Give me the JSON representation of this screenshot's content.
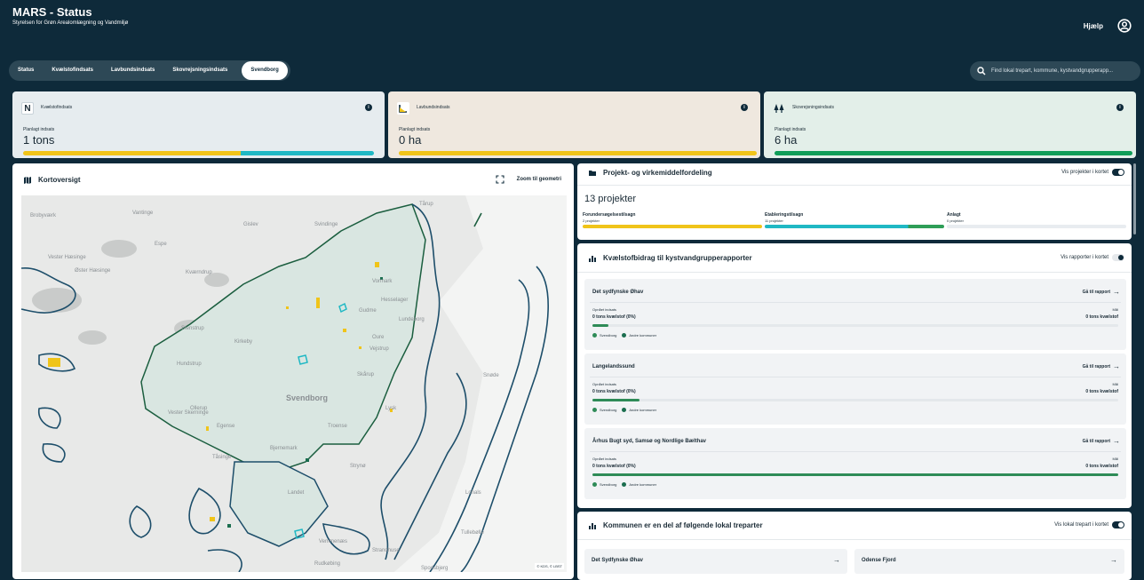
{
  "app": {
    "title": "MARS - Status",
    "subtitle": "Styrelsen for Grøn Arealomlægning og Vandmiljø",
    "help": "Hjælp"
  },
  "tabs": [
    {
      "label": "Status",
      "active": false
    },
    {
      "label": "Kvælstofindsats",
      "active": false
    },
    {
      "label": "Lavbundsindsats",
      "active": false
    },
    {
      "label": "Skovrejsningsindsats",
      "active": false
    },
    {
      "label": "Svendborg",
      "active": true
    }
  ],
  "search": {
    "placeholder": "Find lokal trepart, kommune, kystvandgrupperapp..."
  },
  "kpis": [
    {
      "icon": "N",
      "title": "Kvælstofindsats",
      "planned_label": "Planlagt indsats",
      "value": "1 tons",
      "bg": "#e6ecef",
      "bar": [
        {
          "color": "#f0c419",
          "fraction": 0.62
        },
        {
          "color": "#1fb8c4",
          "fraction": 0.38
        }
      ]
    },
    {
      "icon": "lowland-icon",
      "title": "Lavbundsindsats",
      "planned_label": "Planlagt indsats",
      "value": "0 ha",
      "bg": "#efe8df",
      "bar": [
        {
          "color": "#f0c419",
          "fraction": 1.0
        }
      ]
    },
    {
      "icon": "trees-icon",
      "title": "Skovrejsningsindsats",
      "planned_label": "Planlagt indsats",
      "value": "6 ha",
      "bg": "#e3efe9",
      "bar": [
        {
          "color": "#0f9d58",
          "fraction": 1.0
        }
      ]
    }
  ],
  "map": {
    "title": "Kortoversigt",
    "zoom_label": "Zoom til geometri",
    "copyright": "© KDS, © LBST",
    "place_labels": [
      "Tårup",
      "Brobyværk",
      "Vantinge",
      "Gislev",
      "Svindinge",
      "Espe",
      "Vester Hæsinge",
      "Øster Hæsinge",
      "Kværndrup",
      "Vormark",
      "Hesselager",
      "Gudme",
      "Lundeborg",
      "Stenstrup",
      "Kirkeby",
      "Oure",
      "Vejstrup",
      "Hundstrup",
      "Skårup",
      "Snøde",
      "Svendborg",
      "Vester Skerninge",
      "Ollerup",
      "Egense",
      "Tåsinge",
      "Lysk",
      "Troense",
      "Bjernemark",
      "Strynø",
      "Landet",
      "Vemmenæs",
      "Rudkøbing",
      "Strandhuse",
      "Spodsbjerg",
      "Tullebølle",
      "Lohals"
    ]
  },
  "projects": {
    "title": "Projekt- og virkemiddelfordeling",
    "toggle_label": "Vis projekter i kortet",
    "toggle_on": true,
    "count": "13 projekter",
    "stages": [
      {
        "label": "Forundersøgelsestilsagn",
        "sub": "2 projekter",
        "color": "#f0c419"
      },
      {
        "label": "Etableringstilsagn",
        "sub": "11 projekter",
        "color": "#1fb8c4"
      },
      {
        "label": "Anlagt",
        "sub": "0 projekter",
        "color": "#e4e8eb"
      }
    ]
  },
  "contrib": {
    "title": "Kvælstofbidrag til kystvandgrupperapporter",
    "toggle_label": "Vis rapporter i kortet",
    "toggle_on": false,
    "goto": "Gå til rapport",
    "opnaet_label": "Opnået indsats",
    "maal_label": "Mål",
    "legend_a": "Svendborg",
    "legend_b": "Andre kommuner",
    "reports": [
      {
        "name": "Det sydfynske Øhav",
        "opnaet": "0 tons kvælstof (0%)",
        "maal": "0 tons kvælstof",
        "progress": 0.03
      },
      {
        "name": "Langelandssund",
        "opnaet": "0 tons kvælstof (0%)",
        "maal": "0 tons kvælstof",
        "progress": 0.09
      },
      {
        "name": "Århus Bugt syd, Samsø og Nordlige Bælthav",
        "opnaet": "0 tons kvælstof (0%)",
        "maal": "0 tons kvælstof",
        "progress": 1.0
      }
    ]
  },
  "treparter": {
    "title": "Kommunen er en del af følgende lokal treparter",
    "toggle_label": "Vis lokal trepart i kortet",
    "toggle_on": true,
    "items": [
      "Det Sydfynske Øhav",
      "Odense Fjord"
    ]
  },
  "colors": {
    "dark": "#0e2a3a",
    "yellow": "#f0c419",
    "teal": "#1fb8c4",
    "green": "#2e8b57",
    "other_municipalities": "#1b6e4f"
  }
}
